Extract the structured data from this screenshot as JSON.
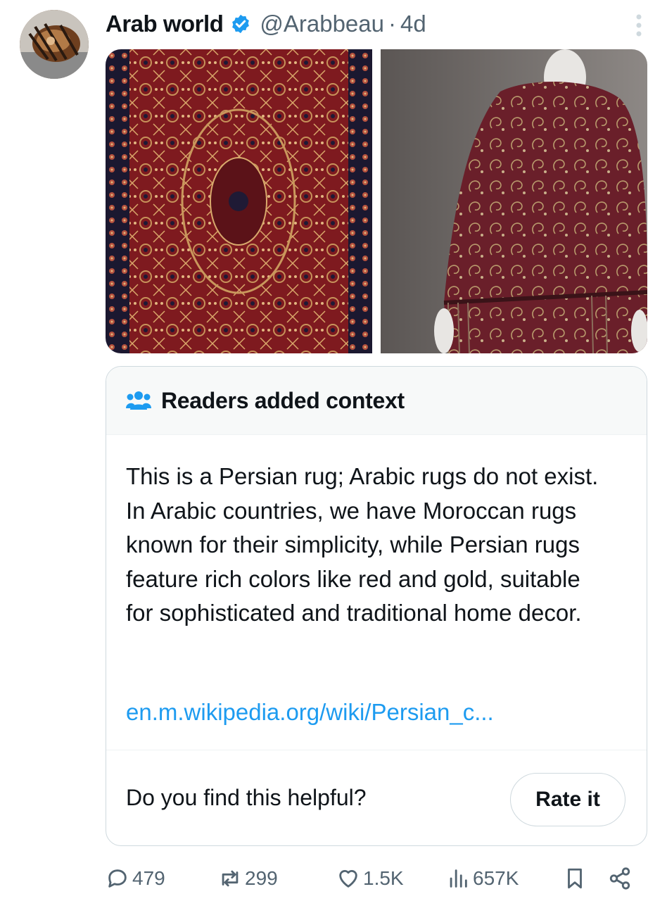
{
  "post": {
    "display_name": "Arab world",
    "handle": "@Arabbeau",
    "separator": "·",
    "time": "4d"
  },
  "media": [
    {
      "name": "persian-rug-photo",
      "description_hidden": true
    },
    {
      "name": "red-shawl-photo",
      "description_hidden": true
    }
  ],
  "community_note": {
    "title": "Readers added context",
    "body": "This is a Persian rug; Arabic rugs do not exist. In Arabic countries, we have Moroccan rugs known for their simplicity, while Persian rugs feature rich colors like red and gold, suitable for sophisticated and traditional home decor.",
    "link": "en.m.wikipedia.org/wiki/Persian_c...",
    "helpful_prompt": "Do you find this helpful?",
    "rate_label": "Rate it"
  },
  "engagement": {
    "replies": "479",
    "reposts": "299",
    "likes": "1.5K",
    "views": "657K"
  },
  "colors": {
    "text": "#0f1419",
    "secondary": "#536471",
    "link": "#1d9bf0",
    "verified": "#1d9bf0",
    "border": "#cfd9de"
  }
}
